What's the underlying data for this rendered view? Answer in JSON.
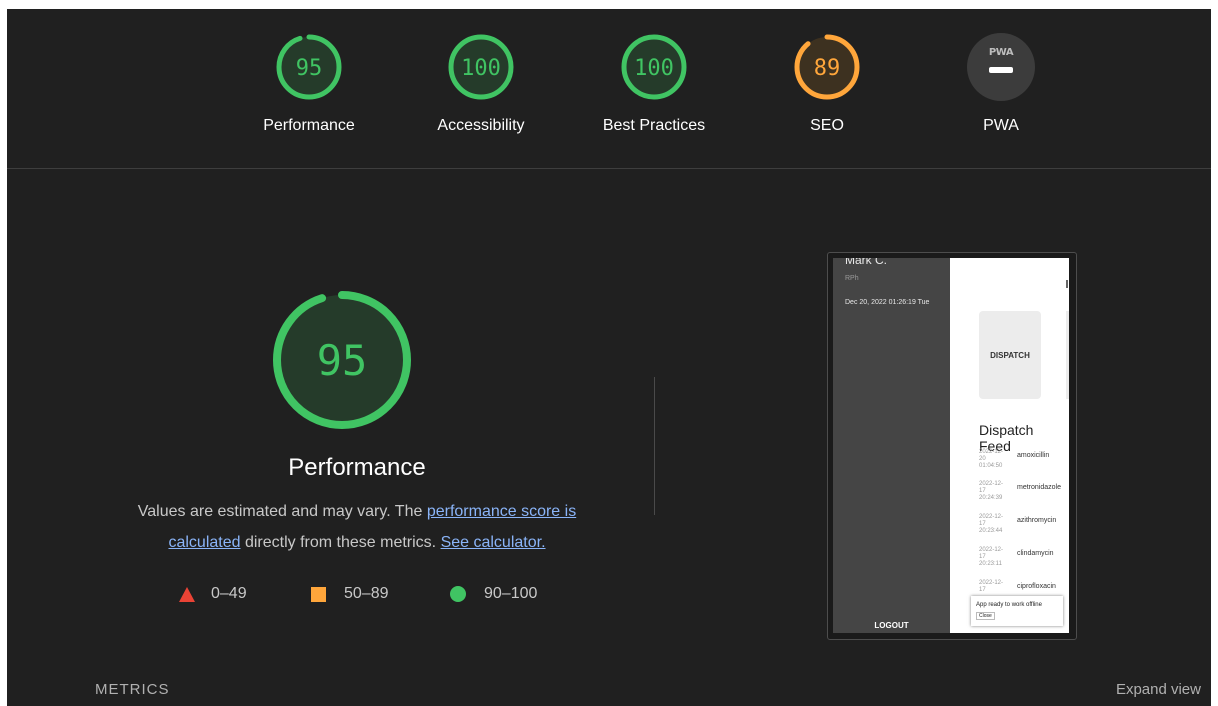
{
  "categories": [
    {
      "label": "Performance",
      "score": "95",
      "value": 95,
      "color": "#40c463"
    },
    {
      "label": "Accessibility",
      "score": "100",
      "value": 100,
      "color": "#40c463"
    },
    {
      "label": "Best Practices",
      "score": "100",
      "value": 100,
      "color": "#40c463"
    },
    {
      "label": "SEO",
      "score": "89",
      "value": 89,
      "color": "#ffa63b"
    },
    {
      "label": "PWA",
      "badge": "PWA"
    }
  ],
  "main": {
    "score": "95",
    "value": 95,
    "title": "Performance",
    "desc_prefix": "Values are estimated and may vary. The ",
    "desc_link": "performance score is calculated",
    "desc_middle": " directly from these metrics. ",
    "desc_link2": "See calculator.",
    "colors": {
      "pass": "#40c463",
      "average": "#ffa63b",
      "fail": "#ea4335"
    }
  },
  "legend": [
    {
      "range": "0–49",
      "shape": "triangle"
    },
    {
      "range": "50–89",
      "shape": "square"
    },
    {
      "range": "90–100",
      "shape": "circle"
    }
  ],
  "screenshot": {
    "user": "Mark C.",
    "role": "RPh",
    "datetime": "Dec 20, 2022 01:26:19 Tue",
    "logout": "LOGOUT",
    "card": "DISPATCH",
    "feed_title": "Dispatch Feed",
    "rows": [
      {
        "time": "2022-12-20 01:04:50",
        "drug": "amoxicillin"
      },
      {
        "time": "2022-12-17 20:24:39",
        "drug": "metronidazole"
      },
      {
        "time": "2022-12-17 20:23:44",
        "drug": "azithromycin"
      },
      {
        "time": "2022-12-17 20:23:11",
        "drug": "clindamycin"
      },
      {
        "time": "2022-12-17",
        "drug": "ciprofloxacin"
      }
    ],
    "toast": "App ready to work offline",
    "toast_close": "Close"
  },
  "footer": {
    "metrics": "METRICS",
    "expand": "Expand view"
  }
}
